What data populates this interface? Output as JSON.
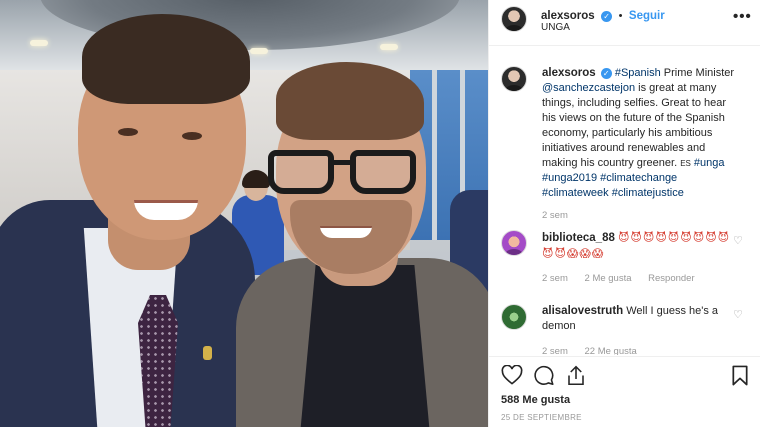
{
  "header": {
    "username": "alexsoros",
    "follow_label": "Seguir",
    "separator": "•",
    "location": "UNGA",
    "more_icon": "more-icon"
  },
  "caption": {
    "username": "alexsoros",
    "text_parts": [
      {
        "t": "#Spanish",
        "tag": true
      },
      {
        "t": " Prime Minister ",
        "tag": false
      },
      {
        "t": "@sanchezcastejon",
        "tag": true
      },
      {
        "t": " is great at many things, including selfies. Great to hear his views on the future of the Spanish economy, particularly his ambitious initiatives around renewables and making his country greener. ",
        "tag": false
      },
      {
        "t": "ES",
        "tag": false,
        "small": true
      },
      {
        "t": " ",
        "tag": false
      },
      {
        "t": "#unga",
        "tag": true
      },
      {
        "t": " ",
        "tag": false
      },
      {
        "t": "#unga2019",
        "tag": true
      },
      {
        "t": " ",
        "tag": false
      },
      {
        "t": "#climatechange",
        "tag": true
      },
      {
        "t": " ",
        "tag": false
      },
      {
        "t": "#climateweek",
        "tag": true
      },
      {
        "t": " ",
        "tag": false
      },
      {
        "t": "#climatejustice",
        "tag": true
      }
    ],
    "time": "2 sem"
  },
  "comments": [
    {
      "username": "biblioteca_88",
      "text": "😈😈😈😈😈😈😈😈😈😈😈😱😱😱",
      "time": "2 sem",
      "likes": "2 Me gusta",
      "reply": "Responder"
    },
    {
      "username": "alisalovestruth",
      "text": "Well I guess he's a demon",
      "time": "2 sem",
      "likes": "22 Me gusta"
    }
  ],
  "footer": {
    "like_icon": "heart-icon",
    "comment_icon": "comment-icon",
    "share_icon": "share-icon",
    "save_icon": "bookmark-icon",
    "likes": "588 Me gusta",
    "date": "25 DE SEPTIEMBRE"
  },
  "colors": {
    "link": "#003569",
    "accent": "#3897f0",
    "muted": "#999999"
  }
}
